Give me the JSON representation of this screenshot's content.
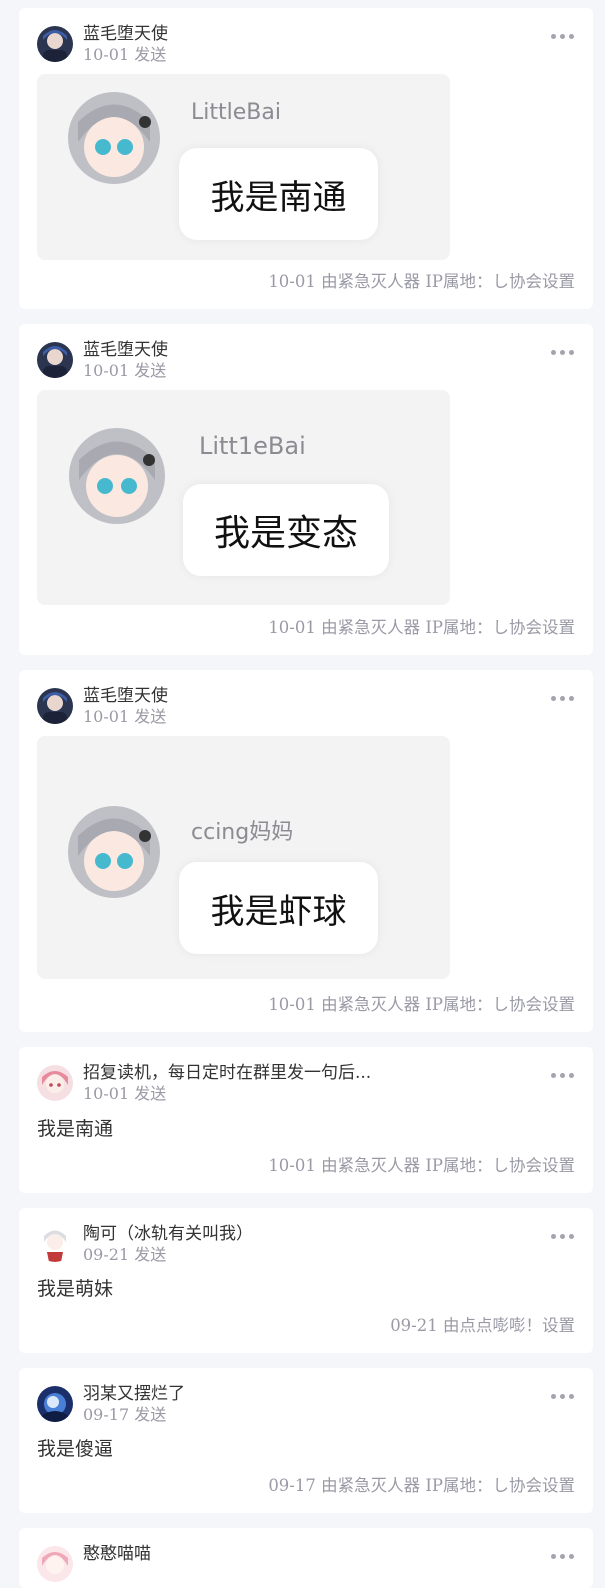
{
  "posts": [
    {
      "author": "蓝毛堕天使",
      "date": "10-01 发送",
      "sticker": {
        "name": "LittleBai",
        "text": "我是南通"
      },
      "footer": "10-01 由紧急灭人器 IP属地：し协会设置"
    },
    {
      "author": "蓝毛堕天使",
      "date": "10-01 发送",
      "sticker": {
        "name": "Litt1eBai",
        "text": "我是变态"
      },
      "footer": "10-01 由紧急灭人器 IP属地：し协会设置"
    },
    {
      "author": "蓝毛堕天使",
      "date": "10-01 发送",
      "sticker": {
        "name": "ccing妈妈",
        "text": "我是虾球"
      },
      "footer": "10-01 由紧急灭人器 IP属地：し协会设置"
    },
    {
      "author": "招复读机，每日定时在群里发一句后...",
      "date": "10-01 发送",
      "text": "我是南通",
      "footer": "10-01 由紧急灭人器 IP属地：し协会设置"
    },
    {
      "author": "陶可（冰轨有关叫我）",
      "date": "09-21 发送",
      "text": "我是萌妹",
      "footer": "09-21 由点点嘭嘭！设置"
    },
    {
      "author": "羽某又摆烂了",
      "date": "09-17 发送",
      "text": "我是傻逼",
      "footer": "09-17 由紧急灭人器 IP属地：し协会设置"
    },
    {
      "author": "憨憨喵喵"
    }
  ],
  "colors": {
    "background": "#f5f6f9",
    "card": "#ffffff",
    "meta": "#9a9aa6"
  },
  "icons": {
    "more": "more-horizontal-icon"
  }
}
